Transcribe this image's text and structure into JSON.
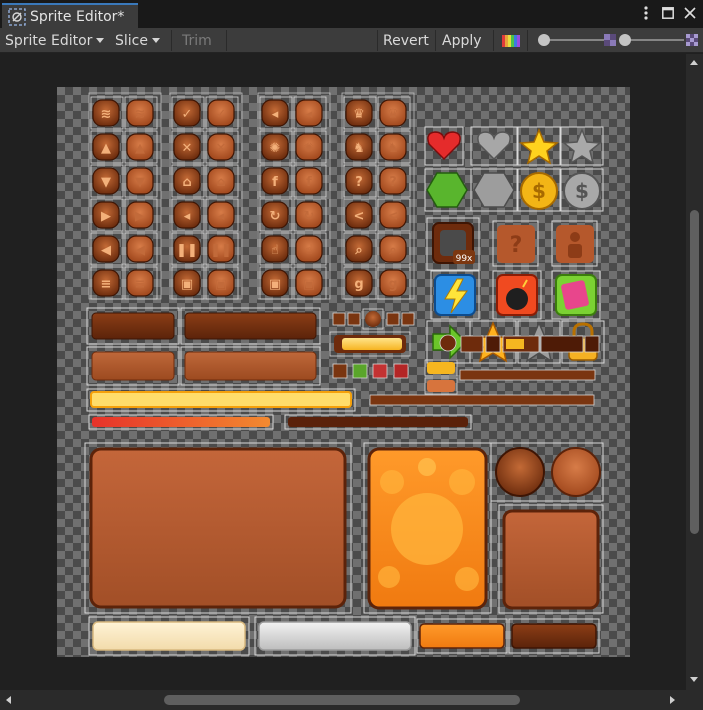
{
  "window": {
    "tab_title": "Sprite Editor*",
    "tab_icon": "sprite-editor-icon"
  },
  "window_controls": [
    "more-options-icon",
    "maximize-icon",
    "close-icon"
  ],
  "toolbar": {
    "sprite_editor_dropdown": "Sprite Editor",
    "slice_dropdown": "Slice",
    "trim_label": "Trim",
    "revert_label": "Revert",
    "apply_label": "Apply",
    "color_channel_icon": "rgb-channel-icon",
    "zoom_slider_value": 0.05,
    "mip_slider_value": 0.05
  },
  "canvas": {
    "background": "checkerboard",
    "sprite_count_hint": "sprite sheet with sliced UI sprites"
  },
  "sprite_labels": {
    "badge": "99x"
  },
  "colors": {
    "accent": "#3a79bb",
    "wood": "#8a3f17",
    "wood_light": "#b7582a",
    "slice_rect": "#d8d8d8",
    "orange": "#f59a1e"
  }
}
